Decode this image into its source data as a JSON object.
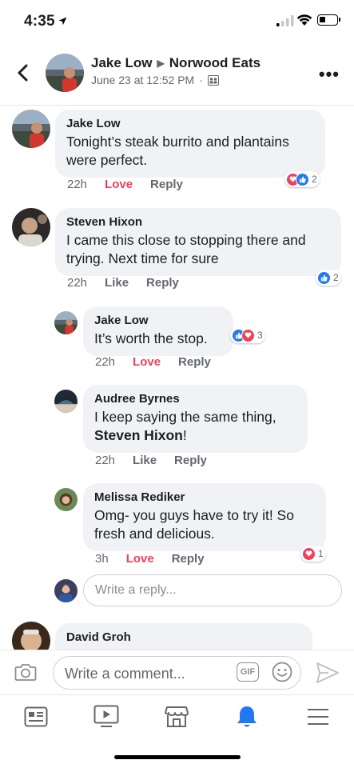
{
  "status_bar": {
    "time": "4:35",
    "battery_level": 0.35
  },
  "post_header": {
    "author": "Jake Low",
    "target_page": "Norwood Eats",
    "timestamp": "June 23 at 12:52 PM",
    "separator": "·"
  },
  "comments": [
    {
      "author": "Jake Low",
      "text": "Tonight’s steak burrito and plantains were perfect.",
      "time": "22h",
      "reaction_label": "Love",
      "reply_label": "Reply",
      "reactions": [
        "heart",
        "like"
      ],
      "reaction_count": "2"
    },
    {
      "author": "Steven Hixon",
      "text": "I came this close to stopping there and trying. Next time for sure",
      "time": "22h",
      "reaction_label": "Like",
      "reply_label": "Reply",
      "reactions": [
        "like"
      ],
      "reaction_count": "2"
    }
  ],
  "replies": [
    {
      "author": "Jake Low",
      "text": "It’s worth the stop.",
      "time": "22h",
      "reaction_label": "Love",
      "reply_label": "Reply",
      "reactions": [
        "like",
        "heart"
      ],
      "reaction_count": "3"
    },
    {
      "author": "Audree Byrnes",
      "text_prefix": "I  keep saying the same thing,",
      "mention": "Steven Hixon",
      "text_suffix": "!",
      "time": "22h",
      "reaction_label": "Like",
      "reply_label": "Reply"
    },
    {
      "author": "Melissa Rediker",
      "text": "Omg- you guys have to try it! So fresh and delicious.",
      "time": "3h",
      "reaction_label": "Love",
      "reply_label": "Reply",
      "reactions": [
        "heart"
      ],
      "reaction_count": "1"
    }
  ],
  "reply_box": {
    "placeholder": "Write a reply..."
  },
  "next_comment": {
    "author": "David Groh"
  },
  "composer": {
    "placeholder": "Write a comment...",
    "gif_label": "GIF"
  },
  "tab_bar": {
    "tabs": [
      {
        "icon": "news-feed-icon",
        "active": false
      },
      {
        "icon": "watch-icon",
        "active": false
      },
      {
        "icon": "marketplace-icon",
        "active": false
      },
      {
        "icon": "notifications-bell-icon",
        "active": true
      },
      {
        "icon": "menu-icon",
        "active": false
      }
    ]
  },
  "colors": {
    "accent": "#2078f4",
    "love": "#f33e58",
    "bubble": "#f0f2f5",
    "muted": "#65676b"
  }
}
